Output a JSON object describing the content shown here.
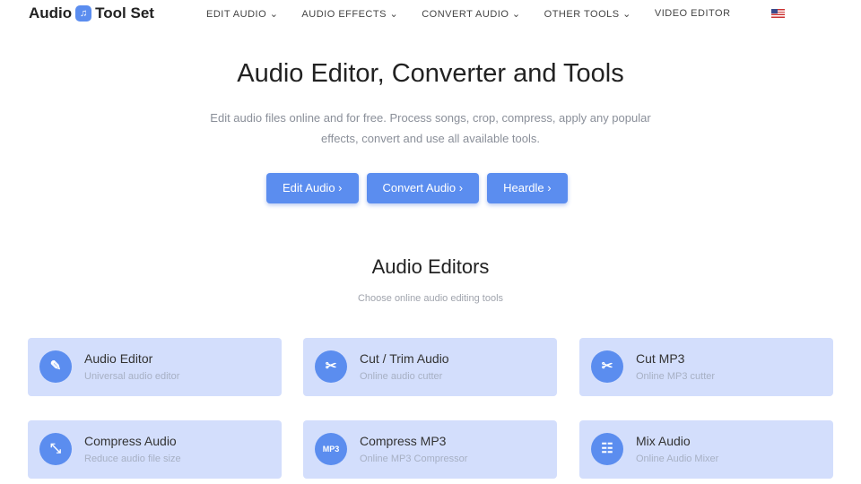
{
  "logo": {
    "left": "Audio",
    "right": "Tool Set"
  },
  "nav": [
    "EDIT AUDIO ⌄",
    "AUDIO EFFECTS ⌄",
    "CONVERT AUDIO ⌄",
    "OTHER TOOLS ⌄",
    "VIDEO EDITOR"
  ],
  "hero": {
    "title": "Audio Editor, Converter and Tools",
    "subtitle": "Edit audio files online and for free. Process songs, crop, compress, apply any popular effects, convert and use all available tools.",
    "buttons": [
      "Edit Audio ›",
      "Convert Audio ›",
      "Heardle ›"
    ]
  },
  "section": {
    "title": "Audio Editors",
    "subtitle": "Choose online audio editing tools"
  },
  "cards": [
    {
      "title": "Audio Editor",
      "desc": "Universal audio editor",
      "icon": "✎"
    },
    {
      "title": "Cut / Trim Audio",
      "desc": "Online audio cutter",
      "icon": "✂"
    },
    {
      "title": "Cut MP3",
      "desc": "Online MP3 cutter",
      "icon": "✂"
    },
    {
      "title": "Compress Audio",
      "desc": "Reduce audio file size",
      "icon": "⤡"
    },
    {
      "title": "Compress MP3",
      "desc": "Online MP3 Compressor",
      "icon": "MP3"
    },
    {
      "title": "Mix Audio",
      "desc": "Online Audio Mixer",
      "icon": "☷"
    }
  ]
}
